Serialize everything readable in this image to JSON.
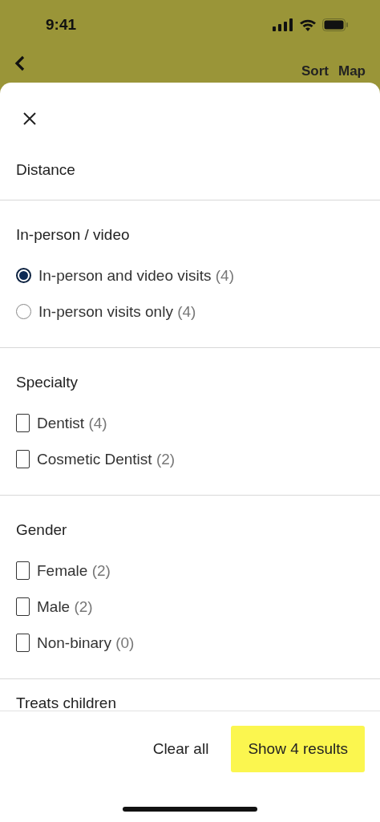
{
  "status_bar": {
    "time": "9:41"
  },
  "nav": {
    "actions": [
      "Sort",
      "Map"
    ]
  },
  "sections": [
    {
      "title": "Distance"
    },
    {
      "title": "In-person / video",
      "options": [
        {
          "kind": "radio",
          "label": "In-person and video visits",
          "count": "(4)",
          "selected": true
        },
        {
          "kind": "radio",
          "label": "In-person visits only",
          "count": "(4)",
          "selected": false
        }
      ]
    },
    {
      "title": "Specialty",
      "options": [
        {
          "kind": "checkbox",
          "label": "Dentist",
          "count": "(4)",
          "checked": false
        },
        {
          "kind": "checkbox",
          "label": "Cosmetic Dentist",
          "count": "(2)",
          "checked": false
        }
      ]
    },
    {
      "title": "Gender",
      "options": [
        {
          "kind": "checkbox",
          "label": "Female",
          "count": "(2)",
          "checked": false
        },
        {
          "kind": "checkbox",
          "label": "Male",
          "count": "(2)",
          "checked": false
        },
        {
          "kind": "checkbox",
          "label": "Non-binary",
          "count": "(0)",
          "checked": false
        }
      ]
    },
    {
      "title": "Treats children"
    }
  ],
  "footer": {
    "clear": "Clear all",
    "show": "Show 4 results"
  }
}
